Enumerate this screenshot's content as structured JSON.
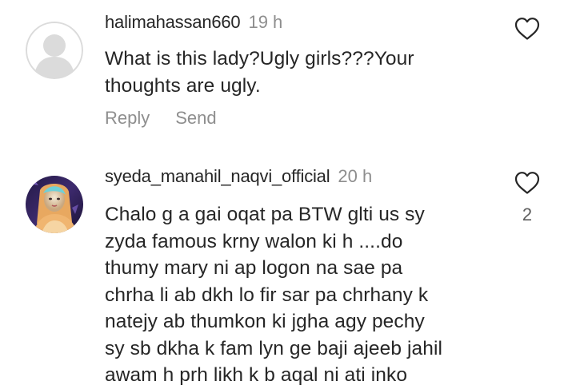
{
  "comments": [
    {
      "username": "halimahassan660",
      "time": "19 h",
      "text_lines": [
        "What is this lady?Ugly girls???Your",
        "thoughts are ugly."
      ],
      "reply_label": "Reply",
      "send_label": "Send"
    },
    {
      "username": "syeda_manahil_naqvi_official",
      "time": "20 h",
      "text_lines": [
        "Chalo g a gai oqat pa BTW glti us sy",
        "zyda famous krny walon ki h ....do",
        "thumy mary ni ap logon na sae pa",
        "chrha li ab dkh lo fir sar pa chrhany k",
        "natejy ab thumkon ki jgha agy pechy",
        "sy sb dkha k fam lyn ge baji ajeeb jahil",
        "awam h prh likh k b aqal ni ati inko"
      ],
      "like_count": "2"
    }
  ],
  "icons": {
    "like": "heart-outline-icon",
    "default_avatar": "default-avatar-icon"
  },
  "colors": {
    "text": "#262626",
    "secondary": "#8e8e8e",
    "avatar_placeholder": "#dbdbdb"
  }
}
